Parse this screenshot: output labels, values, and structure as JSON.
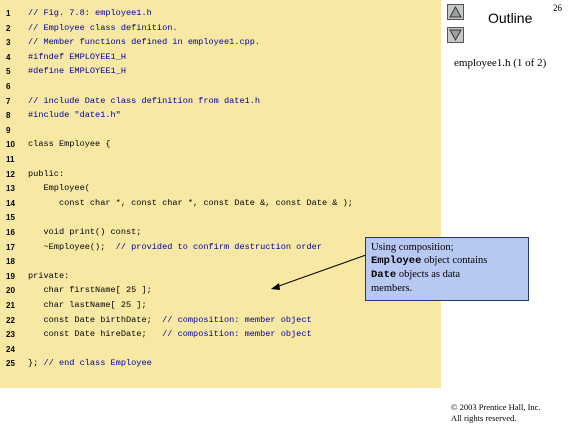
{
  "slide": {
    "number": "26",
    "outline_label": "Outline",
    "file_info": "employee1.h (1 of 2)",
    "nav_up_icon": "triangle-up-icon",
    "nav_down_icon": "triangle-down-icon"
  },
  "code": [
    {
      "n": "1",
      "parts": [
        {
          "t": "// Fig. 7.8: employee1.h",
          "k": "comment"
        }
      ]
    },
    {
      "n": "2",
      "parts": [
        {
          "t": "// Employee class definition.",
          "k": "comment"
        }
      ]
    },
    {
      "n": "3",
      "parts": [
        {
          "t": "// Member functions defined in employee1.cpp.",
          "k": "comment"
        }
      ]
    },
    {
      "n": "4",
      "parts": [
        {
          "t": "#ifndef EMPLOYEE1_H",
          "k": "pre"
        }
      ]
    },
    {
      "n": "5",
      "parts": [
        {
          "t": "#define EMPLOYEE1_H",
          "k": "pre"
        }
      ]
    },
    {
      "n": "6",
      "parts": []
    },
    {
      "n": "7",
      "parts": [
        {
          "t": "// include Date class definition from date1.h",
          "k": "comment"
        }
      ]
    },
    {
      "n": "8",
      "parts": [
        {
          "t": "#include \"date1.h\"",
          "k": "pre"
        }
      ]
    },
    {
      "n": "9",
      "parts": []
    },
    {
      "n": "10",
      "parts": [
        {
          "t": "class Employee {",
          "k": "code"
        }
      ]
    },
    {
      "n": "11",
      "parts": []
    },
    {
      "n": "12",
      "parts": [
        {
          "t": "public:",
          "k": "code"
        }
      ]
    },
    {
      "n": "13",
      "parts": [
        {
          "t": "   Employee(",
          "k": "code"
        }
      ]
    },
    {
      "n": "14",
      "parts": [
        {
          "t": "      const char *, const char *, const Date &, const Date & );",
          "k": "code"
        }
      ]
    },
    {
      "n": "15",
      "parts": []
    },
    {
      "n": "16",
      "parts": [
        {
          "t": "   void print() const;",
          "k": "code"
        }
      ]
    },
    {
      "n": "17",
      "parts": [
        {
          "t": "   ~Employee();  ",
          "k": "code"
        },
        {
          "t": "// provided to confirm destruction order",
          "k": "comment"
        }
      ]
    },
    {
      "n": "18",
      "parts": []
    },
    {
      "n": "19",
      "parts": [
        {
          "t": "private:",
          "k": "code"
        }
      ]
    },
    {
      "n": "20",
      "parts": [
        {
          "t": "   char firstName[ 25 ];",
          "k": "code"
        }
      ]
    },
    {
      "n": "21",
      "parts": [
        {
          "t": "   char lastName[ 25 ];",
          "k": "code"
        }
      ]
    },
    {
      "n": "22",
      "parts": [
        {
          "t": "   const Date birthDate;  ",
          "k": "code"
        },
        {
          "t": "// composition: member object",
          "k": "comment"
        }
      ]
    },
    {
      "n": "23",
      "parts": [
        {
          "t": "   const Date hireDate;   ",
          "k": "code"
        },
        {
          "t": "// composition: member object",
          "k": "comment"
        }
      ]
    },
    {
      "n": "24",
      "parts": []
    },
    {
      "n": "25",
      "parts": [
        {
          "t": "}; ",
          "k": "code"
        },
        {
          "t": "// end class Employee",
          "k": "comment"
        }
      ]
    }
  ],
  "callout": {
    "line1": "Using composition;",
    "mono1": "Employee",
    "line2_rest": " object contains",
    "mono2": "Date",
    "line3_rest": " objects as data",
    "line4": "members."
  },
  "copyright": {
    "line1": "© 2003 Prentice Hall, Inc.",
    "line2": "All rights reserved."
  },
  "colors": {
    "code_background": "#f7e9a4",
    "comment": "#0000a0",
    "callout_background": "#b7c9f3"
  }
}
